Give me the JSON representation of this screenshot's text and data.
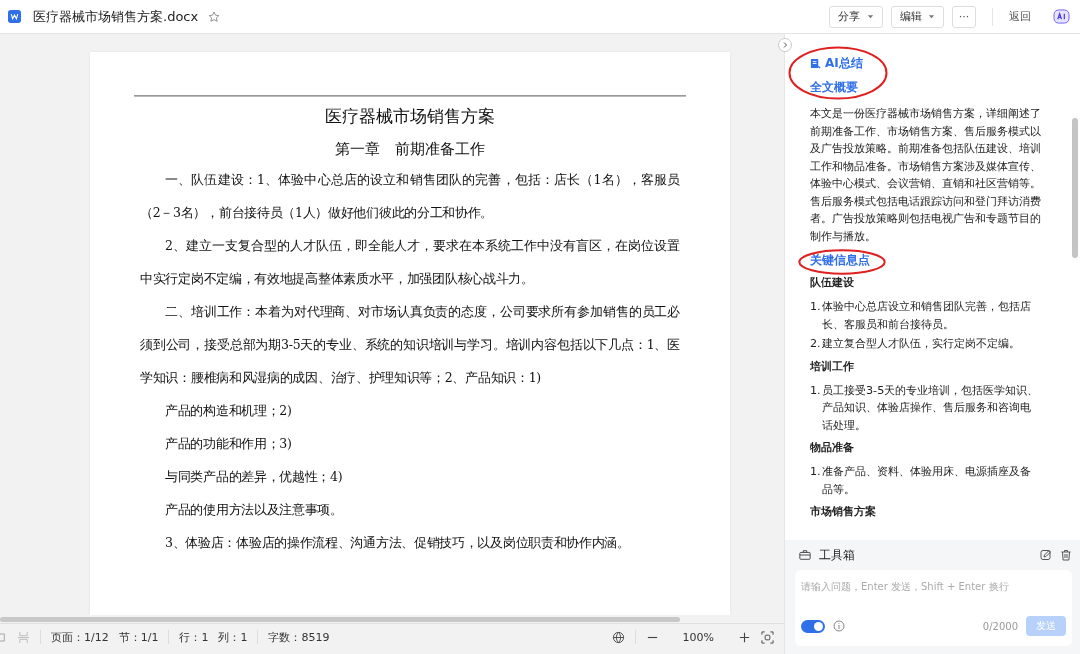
{
  "document": {
    "file_name": "医疗器械市场销售方案.docx",
    "starred": false
  },
  "toolbar": {
    "buttons": [
      {
        "label": "分享"
      },
      {
        "label": "编辑"
      }
    ],
    "more": "···",
    "back": "返回"
  },
  "page": {
    "title": "医疗器械市场销售方案",
    "chapter": "第一章　前期准备工作",
    "paragraphs": [
      {
        "text": "一、队伍建设：1、体验中心总店的设立和销售团队的完善，包括：店长（1名），客服员（2－3名），前台接待员（1人）做好他们彼此的分工和协作。"
      },
      {
        "text": "2、建立一支复合型的人才队伍，即全能人才，要求在本系统工作中没有盲区，在岗位设置中实行定岗不定编，有效地提高整体素质水平，加强团队核心战斗力。"
      },
      {
        "text": "二、培训工作：本着为对代理商、对市场认真负责的态度，公司要求所有参加销售的员工必须到公司，接受总部为期3-5天的专业、系统的知识培训与学习。培训内容包括以下几点：1、医学知识：腰椎病和风湿病的成因、治疗、护理知识等；2、产品知识：1)"
      },
      {
        "text": "产品的构造和机理；2)"
      },
      {
        "text": "产品的功能和作用；3)"
      },
      {
        "text": "与同类产品的差异，优越性；4)"
      },
      {
        "text": "产品的使用方法以及注意事项。"
      },
      {
        "text": "3、体验店：体验店的操作流程、沟通方法、促销技巧，以及岗位职责和协作内涵。"
      }
    ]
  },
  "status_bar": {
    "page": "页面：1/12",
    "section": "节：1/1",
    "line": "行：1",
    "column": "列：1",
    "word_count": "字数：8519",
    "zoom": "100%"
  },
  "assistant": {
    "title": "AI总结",
    "title_circled": true,
    "summary": {
      "heading": "全文概要",
      "body": "本文是一份医疗器械市场销售方案，详细阐述了前期准备工作、市场销售方案、售后服务模式以及广告投放策略。前期准备包括队伍建设、培训工作和物品准备。市场销售方案涉及媒体宣传、体验中心模式、会议营销、直销和社区营销等。售后服务模式包括电话跟踪访问和登门拜访消费者。广告投放策略则包括电视广告和专题节目的制作与播放。"
    },
    "key_points": {
      "heading": "关键信息点",
      "circled": true,
      "groups": [
        {
          "title": "队伍建设",
          "items": [
            {
              "marker": "1.",
              "text": "体验中心总店设立和销售团队完善，包括店长、客服员和前台接待员。"
            },
            {
              "marker": "2.",
              "text": "建立复合型人才队伍，实行定岗不定编。"
            }
          ]
        },
        {
          "title": "培训工作",
          "items": [
            {
              "marker": "1.",
              "text": "员工接受3-5天的专业培训，包括医学知识、产品知识、体验店操作、售后服务和咨询电话处理。"
            }
          ]
        },
        {
          "title": "物品准备",
          "items": [
            {
              "marker": "1.",
              "text": "准备产品、资料、体验用床、电源插座及备品等。"
            }
          ]
        },
        {
          "title": "市场销售方案"
        }
      ]
    }
  },
  "toolbox": {
    "label": "工具箱"
  },
  "composer": {
    "placeholder": "请输入问题，Enter 发送，Shift + Enter 换行",
    "toggle_on": true,
    "counter": "0/2000",
    "send": "发送",
    "send_disabled": true
  }
}
